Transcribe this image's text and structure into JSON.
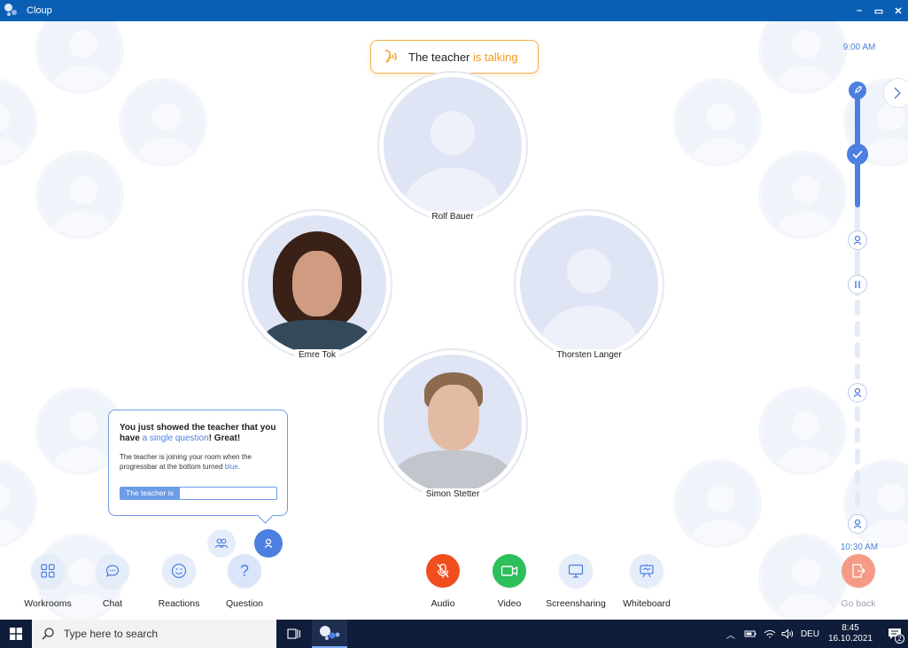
{
  "window": {
    "title": "Cloup",
    "minimize": "–",
    "maximize": "▭",
    "close": "✕"
  },
  "banner": {
    "prefix": "The teacher ",
    "highlight": "is talking"
  },
  "participants": [
    {
      "name": "Rolf Bauer"
    },
    {
      "name": "Emre Tok"
    },
    {
      "name": "Thorsten Langer"
    },
    {
      "name": "Simon Stetter"
    }
  ],
  "timeline": {
    "start": "9:00 AM",
    "end": "10:30 AM"
  },
  "popover": {
    "line1_a": "You just showed the teacher that you have ",
    "line1_hl": "a single question",
    "line1_b": "! Great!",
    "line2_a": "The teacher is joining your room when the progressbar at the bottom turned ",
    "line2_hl": "blue",
    "line2_b": ".",
    "progress_label": "The teacher is",
    "progress_fraction": 0.38
  },
  "toolbar": {
    "workrooms": "Workrooms",
    "chat": "Chat",
    "reactions": "Reactions",
    "question": "Question",
    "audio": "Audio",
    "video": "Video",
    "screensharing": "Screensharing",
    "whiteboard": "Whiteboard",
    "go_back": "Go back"
  },
  "taskbar": {
    "search_placeholder": "Type here to search",
    "language": "DEU",
    "time": "8:45",
    "date": "16.10.2021",
    "notifications": "2"
  },
  "colors": {
    "accent": "#4d7fe0",
    "titlebar": "#0a5fb4",
    "talking": "#f29d1f",
    "audio": "#f04e1f",
    "video": "#2cbf5a"
  }
}
